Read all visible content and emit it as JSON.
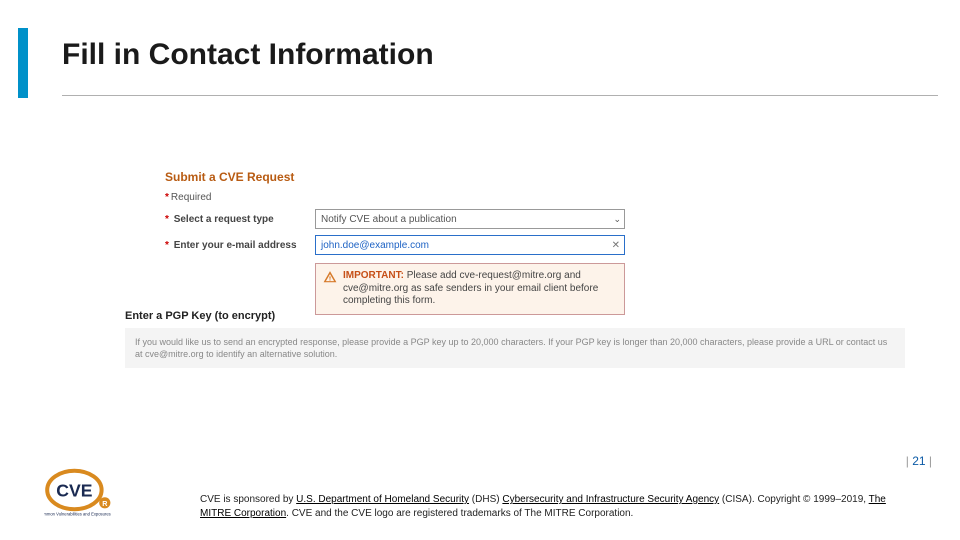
{
  "title": "Fill in Contact Information",
  "form": {
    "heading": "Submit a CVE Request",
    "required_label": "Required",
    "row_type_label": "Select a request type",
    "row_type_value": "Notify CVE about a publication",
    "row_email_label": "Enter your e-mail address",
    "row_email_value": "john.doe@example.com",
    "warn_prefix": "IMPORTANT:",
    "warn_body": "Please add cve-request@mitre.org and cve@mitre.org as safe senders in your email client before completing this form."
  },
  "pgp": {
    "heading": "Enter a PGP Key (to encrypt)",
    "note": "If you would like us to send an encrypted response, please provide a PGP key up to 20,000 characters. If your PGP key is longer than 20,000 characters, please provide a URL or contact us at cve@mitre.org to identify an alternative solution."
  },
  "page_number": "21",
  "footer": {
    "t1": "CVE is sponsored by ",
    "l1": "U.S. Department of Homeland Security",
    "t2": " (DHS) ",
    "l2": "Cybersecurity and Infrastructure Security Agency",
    "t3": " (CISA). Copyright © 1999–2019, ",
    "l3": "The MITRE Corporation",
    "t4": ". CVE and the CVE logo are registered trademarks of The MITRE Corporation."
  },
  "logo_tagline": "Common Vulnerabilities and Exposures"
}
